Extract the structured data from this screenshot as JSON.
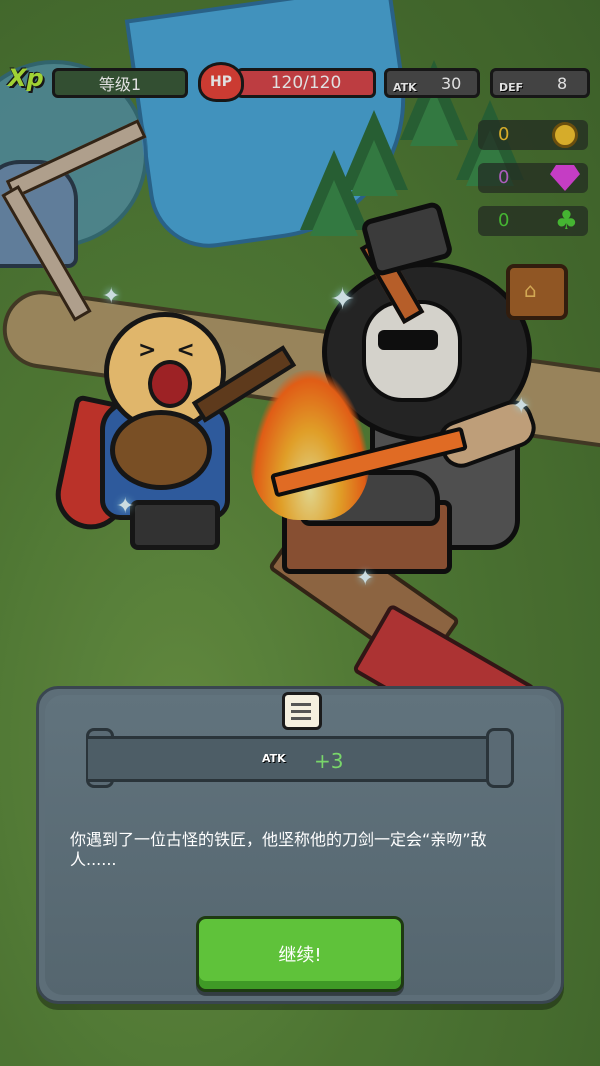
{
  "hud": {
    "xp_badge": "Xp",
    "level_label": "等级1",
    "hp_badge": "HP",
    "hp_value": "120/120",
    "atk_label": "ATK",
    "atk_value": "30",
    "def_label": "DEF",
    "def_value": "8"
  },
  "resources": {
    "coins": "0",
    "gems": "0",
    "clovers": "0"
  },
  "event": {
    "reward_stat": "ATK",
    "reward_value": "+3",
    "description": "你遇到了一位古怪的铁匠，他坚称他的刀剑一定会“亲吻”敌人......",
    "continue_label": "继续!"
  },
  "colors": {
    "xp_accent": "#b8f03c",
    "hp_red": "#d8464a",
    "coin_gold": "#f4c430",
    "gem_pink": "#e146e0",
    "clover_green": "#4fcf3a",
    "reward_green": "#79d66a",
    "button_green": "#5fc23a"
  }
}
